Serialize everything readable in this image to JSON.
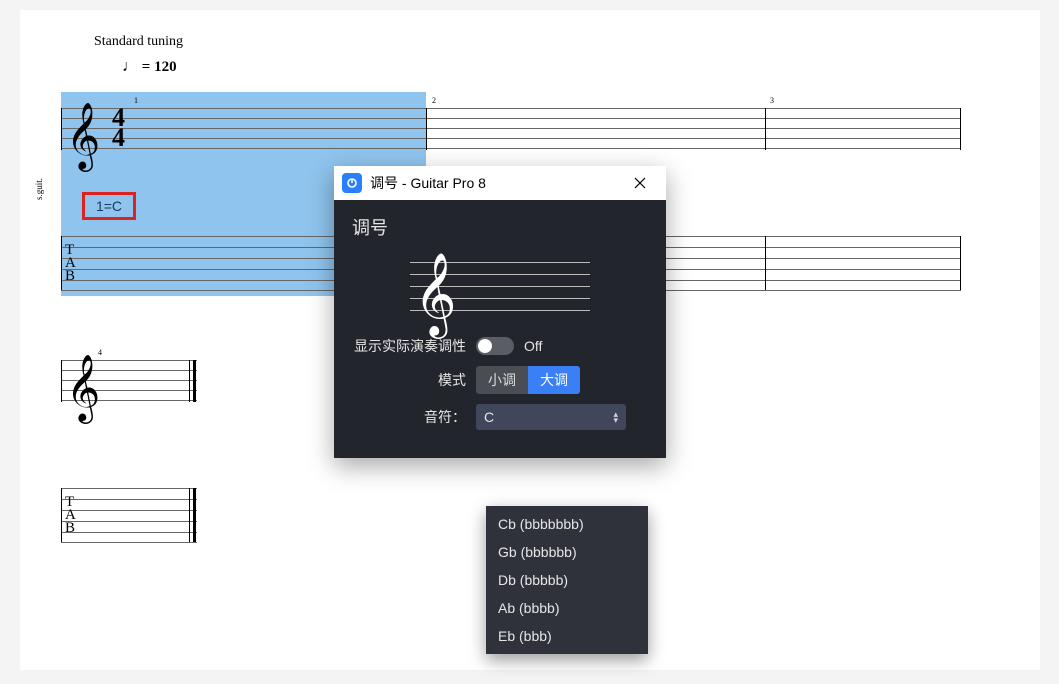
{
  "tuning_label": "Standard tuning",
  "tempo": {
    "note": "♩",
    "eq": " = ",
    "value": "120"
  },
  "track_label": "s.guit.",
  "time_sig": {
    "num": "4",
    "den": "4"
  },
  "key_badge": "1=C",
  "tab_letters": "T\nA\nB",
  "measure_numbers": [
    "1",
    "2",
    "3",
    "4"
  ],
  "dialog": {
    "title": "调号 - Guitar Pro 8",
    "header": "调号",
    "show_label": "显示实际演奏调性",
    "show_state": "Off",
    "mode_label": "模式",
    "mode_minor": "小调",
    "mode_major": "大调",
    "note_label": "音符：",
    "note_selected": "C",
    "options": [
      "Cb (bbbbbbb)",
      "Gb (bbbbbb)",
      "Db (bbbbb)",
      "Ab (bbbb)",
      "Eb (bbb)"
    ]
  }
}
